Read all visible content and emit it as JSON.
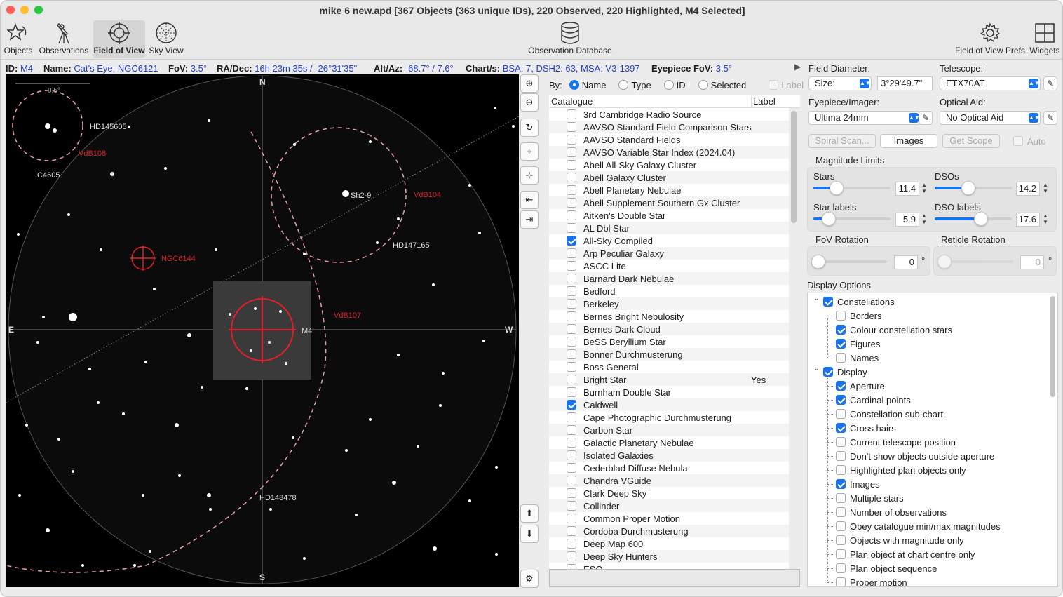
{
  "window": {
    "title": "mike 6 new.apd [367 Objects (363 unique IDs), 220 Observed, 220 Highlighted, M4 Selected]"
  },
  "toolbar": {
    "objects": "Objects",
    "observations": "Observations",
    "field_of_view": "Field of View",
    "sky_view": "Sky View",
    "observation_database": "Observation Database",
    "fov_prefs": "Field of View Prefs",
    "widgets": "Widgets"
  },
  "info": {
    "id_label": "ID:",
    "id_value": "M4",
    "name_label": "Name:",
    "name_value": "Cat's Eye, NGC6121",
    "fov_label": "FoV:",
    "fov_value": "3.5°",
    "radec_label": "RA/Dec:",
    "radec_value": "16h 23m 35s / -26°31'35\"",
    "altaz_label": "Alt/Az:",
    "altaz_value": "-68.7° / 7.6°",
    "charts_label": "Chart/s:",
    "charts_value": "BSA: 7, DSH2: 63, MSA: V3-1397",
    "eyepiece_fov_label": "Eyepiece FoV:",
    "eyepiece_fov_value": "3.5°"
  },
  "chart": {
    "scale_label": "0.5°",
    "dir_n": "N",
    "dir_s": "S",
    "dir_e": "E",
    "dir_w": "W",
    "labels": {
      "hd145605": "HD145605",
      "vdb108": "VdB108",
      "ic4605": "IC4605",
      "sh2_9": "Sh2-9",
      "vdb104": "VdB104",
      "hd147165": "HD147165",
      "ngc6144": "NGC6144",
      "vdb107": "VdB107",
      "m4": "M4",
      "hd148478": "HD148478"
    }
  },
  "catalogue_panel": {
    "by_label": "By:",
    "sort_options": [
      "Name",
      "Type",
      "ID",
      "Selected"
    ],
    "sort_selected": "Name",
    "label_checkbox": "Label",
    "col_catalogue": "Catalogue",
    "col_label": "Label",
    "rows": [
      {
        "name": "3rd Cambridge Radio Source",
        "checked": false,
        "label": ""
      },
      {
        "name": "AAVSO Standard Field Comparison Stars",
        "checked": false,
        "label": ""
      },
      {
        "name": "AAVSO Standard Fields",
        "checked": false,
        "label": ""
      },
      {
        "name": "AAVSO Variable Star Index (2024.04)",
        "checked": false,
        "label": ""
      },
      {
        "name": "Abell All-Sky Galaxy Cluster",
        "checked": false,
        "label": ""
      },
      {
        "name": "Abell Galaxy Cluster",
        "checked": false,
        "label": ""
      },
      {
        "name": "Abell Planetary Nebulae",
        "checked": false,
        "label": ""
      },
      {
        "name": "Abell Supplement Southern Gx Cluster",
        "checked": false,
        "label": ""
      },
      {
        "name": "Aitken's Double Star",
        "checked": false,
        "label": ""
      },
      {
        "name": "AL Dbl Star",
        "checked": false,
        "label": ""
      },
      {
        "name": "All-Sky Compiled",
        "checked": true,
        "label": ""
      },
      {
        "name": "Arp Peculiar Galaxy",
        "checked": false,
        "label": ""
      },
      {
        "name": "ASCC Lite",
        "checked": false,
        "label": ""
      },
      {
        "name": "Barnard Dark Nebulae",
        "checked": false,
        "label": ""
      },
      {
        "name": "Bedford",
        "checked": false,
        "label": ""
      },
      {
        "name": "Berkeley",
        "checked": false,
        "label": ""
      },
      {
        "name": "Bernes Bright Nebulosity",
        "checked": false,
        "label": ""
      },
      {
        "name": "Bernes Dark Cloud",
        "checked": false,
        "label": ""
      },
      {
        "name": "BeSS Beryllium Star",
        "checked": false,
        "label": ""
      },
      {
        "name": "Bonner Durchmusterung",
        "checked": false,
        "label": ""
      },
      {
        "name": "Boss General",
        "checked": false,
        "label": ""
      },
      {
        "name": "Bright Star",
        "checked": false,
        "label": "Yes"
      },
      {
        "name": "Burnham Double Star",
        "checked": false,
        "label": ""
      },
      {
        "name": "Caldwell",
        "checked": true,
        "label": ""
      },
      {
        "name": "Cape Photographic Durchmusterung",
        "checked": false,
        "label": ""
      },
      {
        "name": "Carbon Star",
        "checked": false,
        "label": ""
      },
      {
        "name": "Galactic Planetary Nebulae",
        "checked": false,
        "label": ""
      },
      {
        "name": "Isolated Galaxies",
        "checked": false,
        "label": ""
      },
      {
        "name": "Cederblad Diffuse Nebula",
        "checked": false,
        "label": ""
      },
      {
        "name": "Chandra VGuide",
        "checked": false,
        "label": ""
      },
      {
        "name": "Clark Deep Sky",
        "checked": false,
        "label": ""
      },
      {
        "name": "Collinder",
        "checked": false,
        "label": ""
      },
      {
        "name": "Common Proper Motion",
        "checked": false,
        "label": ""
      },
      {
        "name": "Cordoba Durchmusterung",
        "checked": false,
        "label": ""
      },
      {
        "name": "Deep Map 600",
        "checked": false,
        "label": ""
      },
      {
        "name": "Deep Sky Hunters",
        "checked": false,
        "label": ""
      },
      {
        "name": "ESO",
        "checked": false,
        "label": ""
      }
    ]
  },
  "settings": {
    "field_diameter_label": "Field Diameter:",
    "size_select": "Size:",
    "size_value": "3°29'49.7\"",
    "telescope_label": "Telescope:",
    "telescope_value": "ETX70AT",
    "eyepiece_label": "Eyepiece/Imager:",
    "eyepiece_value": "Ultima 24mm",
    "optical_aid_label": "Optical Aid:",
    "optical_aid_value": "No Optical Aid",
    "spiral_scan": "Spiral Scan...",
    "images": "Images",
    "get_scope": "Get Scope",
    "auto": "Auto",
    "magnitude_limits": "Magnitude Limits",
    "stars_label": "Stars",
    "stars_value": "11.4",
    "stars_level": 0.3,
    "dsos_label": "DSOs",
    "dsos_value": "14.2",
    "dsos_level": 0.44,
    "star_labels_label": "Star labels",
    "star_labels_value": "5.9",
    "star_labels_level": 0.2,
    "dso_labels_label": "DSO labels",
    "dso_labels_value": "17.6",
    "dso_labels_level": 0.6,
    "fov_rotation_label": "FoV Rotation",
    "fov_rotation_value": "0",
    "reticle_rotation_label": "Reticle Rotation",
    "reticle_rotation_value": "0",
    "degree": "°",
    "display_options_label": "Display Options",
    "display_options": [
      {
        "label": "Constellations",
        "checked": true,
        "level": 0
      },
      {
        "label": "Borders",
        "checked": false,
        "level": 1
      },
      {
        "label": "Colour constellation stars",
        "checked": true,
        "level": 1
      },
      {
        "label": "Figures",
        "checked": true,
        "level": 1
      },
      {
        "label": "Names",
        "checked": false,
        "level": 1
      },
      {
        "label": "Display",
        "checked": true,
        "level": 0
      },
      {
        "label": "Aperture",
        "checked": true,
        "level": 1
      },
      {
        "label": "Cardinal points",
        "checked": true,
        "level": 1
      },
      {
        "label": "Constellation sub-chart",
        "checked": false,
        "level": 1
      },
      {
        "label": "Cross hairs",
        "checked": true,
        "level": 1
      },
      {
        "label": "Current telescope position",
        "checked": false,
        "level": 1
      },
      {
        "label": "Don't show objects outside aperture",
        "checked": false,
        "level": 1
      },
      {
        "label": "Highlighted plan objects only",
        "checked": false,
        "level": 1
      },
      {
        "label": "Images",
        "checked": true,
        "level": 1
      },
      {
        "label": "Multiple stars",
        "checked": false,
        "level": 1
      },
      {
        "label": "Number of observations",
        "checked": false,
        "level": 1
      },
      {
        "label": "Obey catalogue min/max magnitudes",
        "checked": false,
        "level": 1
      },
      {
        "label": "Objects with magnitude only",
        "checked": false,
        "level": 1
      },
      {
        "label": "Plan object at chart centre only",
        "checked": false,
        "level": 1
      },
      {
        "label": "Plan object sequence",
        "checked": false,
        "level": 1
      },
      {
        "label": "Proper motion",
        "checked": false,
        "level": 1
      }
    ]
  },
  "colors": {
    "accent": "#1a73e8",
    "info_value": "#2340c8",
    "chart_red": "#e0202a",
    "dashed_circle": "#e8a0a0"
  }
}
